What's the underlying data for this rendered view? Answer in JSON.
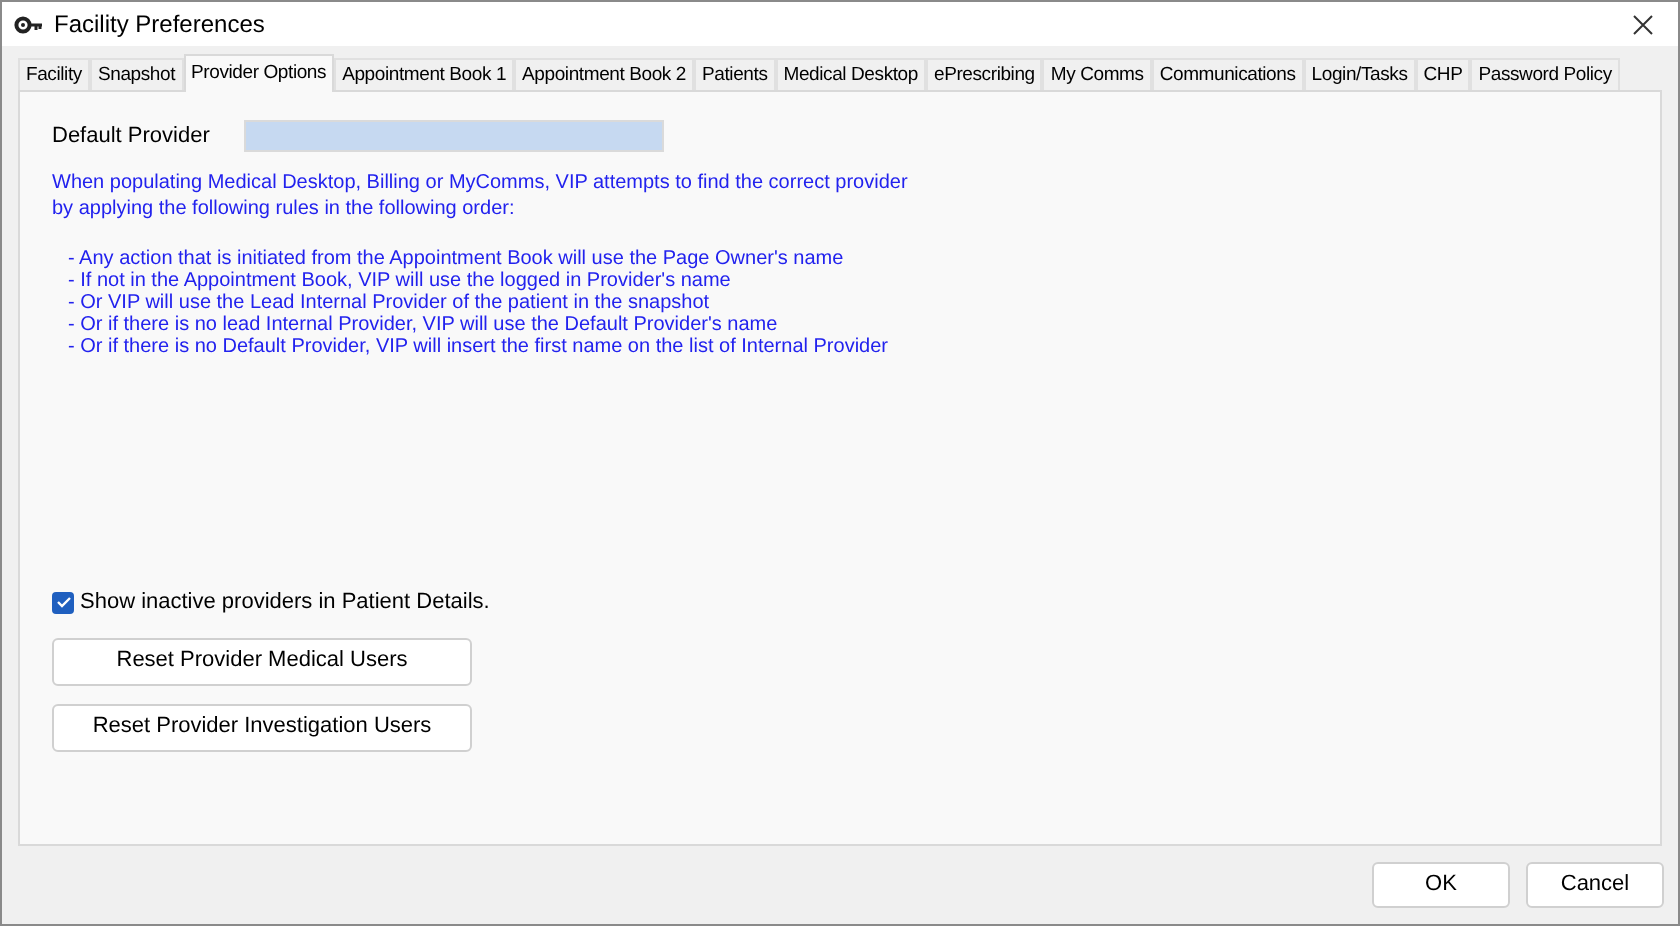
{
  "window": {
    "title": "Facility Preferences"
  },
  "tabs": [
    {
      "label": "Facility",
      "selected": false
    },
    {
      "label": "Snapshot",
      "selected": false
    },
    {
      "label": "Provider Options",
      "selected": true
    },
    {
      "label": "Appointment Book 1",
      "selected": false
    },
    {
      "label": "Appointment Book 2",
      "selected": false
    },
    {
      "label": "Patients",
      "selected": false
    },
    {
      "label": "Medical Desktop",
      "selected": false
    },
    {
      "label": "ePrescribing",
      "selected": false
    },
    {
      "label": "My Comms",
      "selected": false
    },
    {
      "label": "Communications",
      "selected": false
    },
    {
      "label": "Login/Tasks",
      "selected": false
    },
    {
      "label": "CHP",
      "selected": false
    },
    {
      "label": "Password Policy",
      "selected": false
    }
  ],
  "default_provider": {
    "label": "Default Provider"
  },
  "intro": "When populating Medical Desktop, Billing or MyComms, VIP attempts to find the correct provider by applying the following rules in the following order:",
  "rules": [
    "- Any action that is initiated from the Appointment Book will use the Page Owner's name",
    "- If not in the Appointment Book, VIP will use the logged in Provider's name",
    "- Or VIP will use the Lead Internal Provider of the patient in the snapshot",
    "- Or if there is no lead Internal Provider, VIP will use the Default Provider's name",
    "- Or if there is no Default Provider, VIP will insert the first name on the list of Internal Provider"
  ],
  "show_inactive": {
    "label": "Show inactive providers in Patient Details.",
    "checked": true
  },
  "actions": [
    "Reset Provider Medical Users",
    "Reset Provider Investigation Users"
  ],
  "buttons": [
    "OK",
    "Cancel"
  ]
}
